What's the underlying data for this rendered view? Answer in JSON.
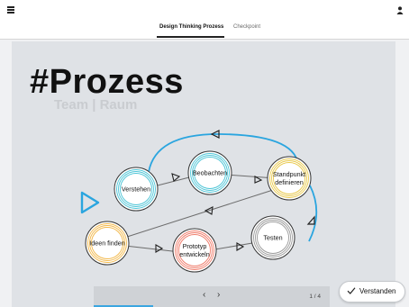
{
  "header": {
    "menu_icon": "hamburger-menu-icon",
    "user_icon": "user-icon"
  },
  "tabs": [
    {
      "label": "Design Thinking Prozess",
      "active": true
    },
    {
      "label": "Checkpoint",
      "active": false
    }
  ],
  "slide": {
    "title": "#Prozess",
    "subtitle": "Team | Raum",
    "nodes": [
      {
        "id": "verstehen",
        "lines": [
          "Verstehen"
        ],
        "color": "#4bc4d6"
      },
      {
        "id": "beobachten",
        "lines": [
          "Beobachten"
        ],
        "color": "#4bc4d6"
      },
      {
        "id": "standpunkt",
        "lines": [
          "Standpunkt",
          "definieren"
        ],
        "color": "#e8c84a"
      },
      {
        "id": "ideen",
        "lines": [
          "Ideen finden"
        ],
        "color": "#f2b84b"
      },
      {
        "id": "prototyp",
        "lines": [
          "Prototyp",
          "entwickeln"
        ],
        "color": "#ef7b6a"
      },
      {
        "id": "testen",
        "lines": [
          "Testen"
        ],
        "color": "#9a9a9a"
      }
    ],
    "colors": {
      "loop": "#2aa5df",
      "connector": "#6c6c6c",
      "start_arrow": "#2aa5df"
    }
  },
  "nav": {
    "prev_icon": "chevron-left-icon",
    "next_icon": "chevron-right-icon",
    "prev": "‹",
    "next": "›",
    "page": "1 / 4",
    "progress": 0.25
  },
  "confirm": {
    "label": "Verstanden",
    "icon": "check-icon"
  }
}
